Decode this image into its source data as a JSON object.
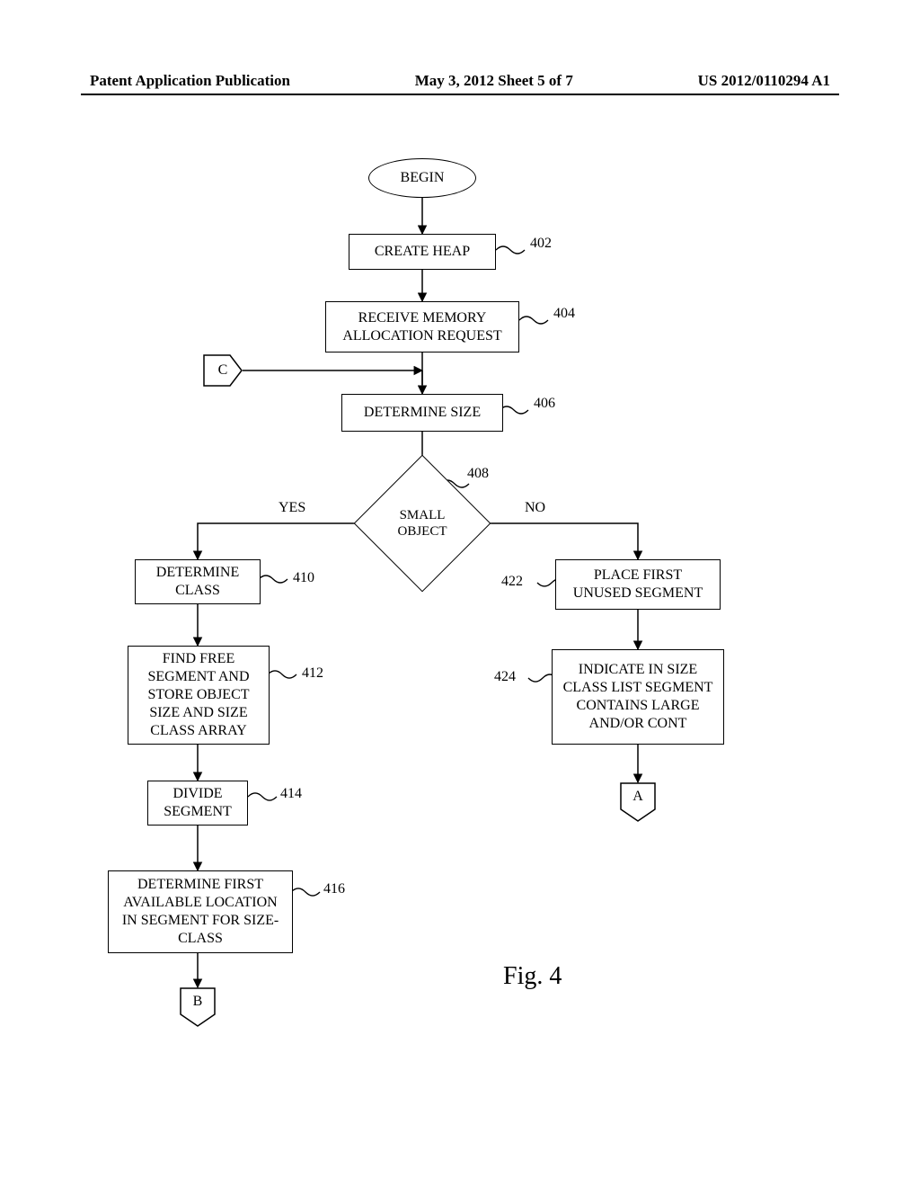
{
  "header": {
    "left": "Patent Application Publication",
    "center": "May 3, 2012  Sheet 5 of 7",
    "right": "US 2012/0110294 A1"
  },
  "figure_label": "Fig. 4",
  "nodes": {
    "begin": "BEGIN",
    "create_heap": "CREATE HEAP",
    "receive_request": "RECEIVE MEMORY ALLOCATION REQUEST",
    "determine_size": "DETERMINE SIZE",
    "small_object": "SMALL OBJECT",
    "determine_class": "DETERMINE CLASS",
    "find_free_segment": "FIND FREE SEGMENT AND STORE OBJECT SIZE AND SIZE CLASS ARRAY",
    "divide_segment": "DIVIDE SEGMENT",
    "determine_first_available": "DETERMINE FIRST AVAILABLE LOCATION IN SEGMENT FOR SIZE-CLASS",
    "place_first_unused": "PLACE FIRST UNUSED SEGMENT",
    "indicate_size_class": "INDICATE IN SIZE CLASS LIST SEGMENT CONTAINS LARGE AND/OR CONT"
  },
  "branches": {
    "yes": "YES",
    "no": "NO"
  },
  "refs": {
    "r402": "402",
    "r404": "404",
    "r406": "406",
    "r408": "408",
    "r410": "410",
    "r412": "412",
    "r414": "414",
    "r416": "416",
    "r422": "422",
    "r424": "424"
  },
  "connectors": {
    "a": "A",
    "b": "B",
    "c": "C"
  },
  "chart_data": {
    "type": "flowchart",
    "title": "Fig. 4",
    "nodes": [
      {
        "id": "begin",
        "type": "terminator",
        "label": "BEGIN"
      },
      {
        "id": "402",
        "type": "process",
        "label": "CREATE HEAP",
        "ref": "402"
      },
      {
        "id": "404",
        "type": "process",
        "label": "RECEIVE MEMORY ALLOCATION REQUEST",
        "ref": "404"
      },
      {
        "id": "C_in",
        "type": "offpage-in",
        "label": "C"
      },
      {
        "id": "406",
        "type": "process",
        "label": "DETERMINE SIZE",
        "ref": "406"
      },
      {
        "id": "408",
        "type": "decision",
        "label": "SMALL OBJECT",
        "ref": "408"
      },
      {
        "id": "410",
        "type": "process",
        "label": "DETERMINE CLASS",
        "ref": "410"
      },
      {
        "id": "412",
        "type": "process",
        "label": "FIND FREE SEGMENT AND STORE OBJECT SIZE AND SIZE CLASS ARRAY",
        "ref": "412"
      },
      {
        "id": "414",
        "type": "process",
        "label": "DIVIDE SEGMENT",
        "ref": "414"
      },
      {
        "id": "416",
        "type": "process",
        "label": "DETERMINE FIRST AVAILABLE LOCATION IN SEGMENT FOR SIZE-CLASS",
        "ref": "416"
      },
      {
        "id": "B_out",
        "type": "offpage-out",
        "label": "B"
      },
      {
        "id": "422",
        "type": "process",
        "label": "PLACE FIRST UNUSED SEGMENT",
        "ref": "422"
      },
      {
        "id": "424",
        "type": "process",
        "label": "INDICATE IN SIZE CLASS LIST SEGMENT CONTAINS LARGE AND/OR CONT",
        "ref": "424"
      },
      {
        "id": "A_out",
        "type": "offpage-out",
        "label": "A"
      }
    ],
    "edges": [
      {
        "from": "begin",
        "to": "402"
      },
      {
        "from": "402",
        "to": "404"
      },
      {
        "from": "404",
        "to": "406"
      },
      {
        "from": "C_in",
        "to": "406",
        "note": "joins flow into 406"
      },
      {
        "from": "406",
        "to": "408"
      },
      {
        "from": "408",
        "to": "410",
        "label": "YES"
      },
      {
        "from": "408",
        "to": "422",
        "label": "NO"
      },
      {
        "from": "410",
        "to": "412"
      },
      {
        "from": "412",
        "to": "414"
      },
      {
        "from": "414",
        "to": "416"
      },
      {
        "from": "416",
        "to": "B_out"
      },
      {
        "from": "422",
        "to": "424"
      },
      {
        "from": "424",
        "to": "A_out"
      }
    ]
  }
}
